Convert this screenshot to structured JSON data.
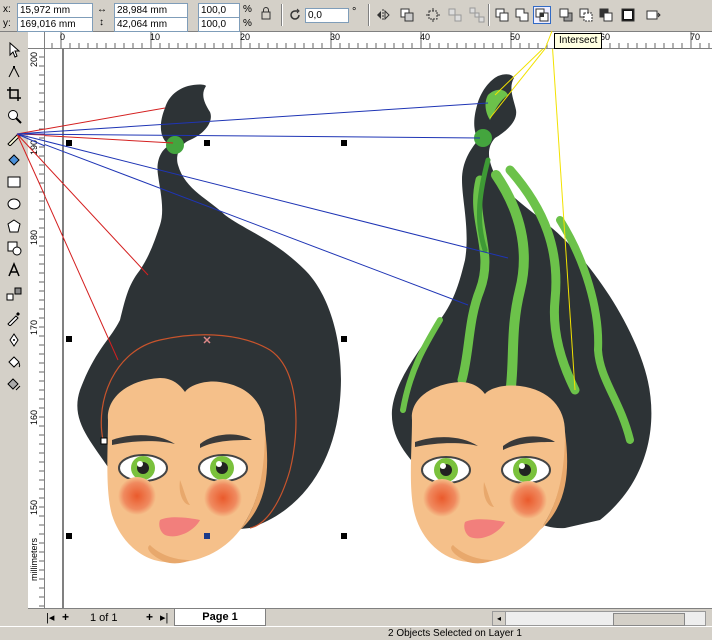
{
  "props": {
    "x_label": "x:",
    "x_value": "15,972 mm",
    "y_label": "y:",
    "y_value": "169,016 mm",
    "width_value": "28,984 mm",
    "height_value": "42,064 mm",
    "scale_w": "100,0",
    "scale_h": "100,0",
    "percent_symbol": "%",
    "angle_value": "0,0",
    "degree_symbol": "°"
  },
  "tooltip": "Intersect",
  "ruler": {
    "h_ticks": [
      "0",
      "10",
      "20",
      "30",
      "40",
      "50",
      "60",
      "70"
    ],
    "v_ticks": [
      "200",
      "190",
      "180",
      "170",
      "160",
      "150"
    ],
    "unit": "millimeters"
  },
  "pages": {
    "counter": "1 of 1",
    "tab": "Page 1"
  },
  "status": "2 Objects Selected on Layer 1",
  "colors": {
    "hair": "#2d3336",
    "skin": "#f5c08a",
    "green_hair": "#6cc24a",
    "blue_line": "#1f35b5",
    "red_line": "#d42020",
    "yellow_line": "#f2e200",
    "blush": "#ef7a52",
    "ui_bg": "#d4d0c8"
  }
}
